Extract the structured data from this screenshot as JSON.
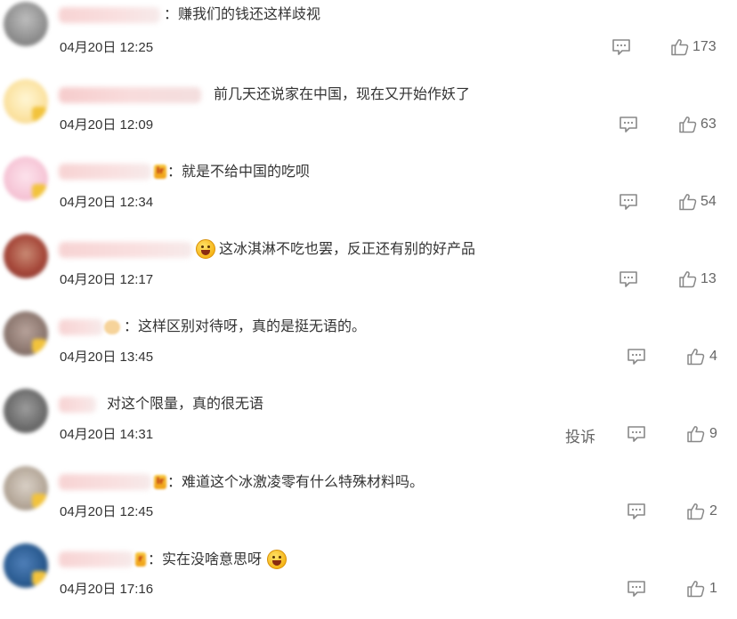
{
  "comments": [
    {
      "text": "：赚我们的钱还这样歧视",
      "time": "04月20日 12:25",
      "likes": "173"
    },
    {
      "text": "前几天还说家在中国，现在又开始作妖了",
      "time": "04月20日 12:09",
      "likes": "63"
    },
    {
      "text": "：就是不给中国的吃呗",
      "time": "04月20日 12:34",
      "likes": "54"
    },
    {
      "text": "这冰淇淋不吃也罢，反正还有别的好产品",
      "time": "04月20日 12:17",
      "likes": "13"
    },
    {
      "text": "：这样区别对待呀，真的是挺无语的。",
      "time": "04月20日 13:45",
      "likes": "4"
    },
    {
      "text": "对这个限量，真的很无语",
      "time": "04月20日 14:31",
      "likes": "9",
      "report": "投诉"
    },
    {
      "text": "：难道这个冰激凌零有什么特殊材料吗。",
      "time": "04月20日 12:45",
      "likes": "2"
    },
    {
      "text": "：实在没啥意思呀",
      "time": "04月20日 17:16",
      "likes": "1"
    }
  ],
  "icons": {
    "reply": "comment-icon",
    "like": "thumbs-up-icon",
    "emoji_laugh": "laughing-emoji-icon"
  },
  "colors": {
    "text": "#333333",
    "meta": "#666666",
    "icon": "#888888",
    "vip_badge": "#f0a014"
  }
}
